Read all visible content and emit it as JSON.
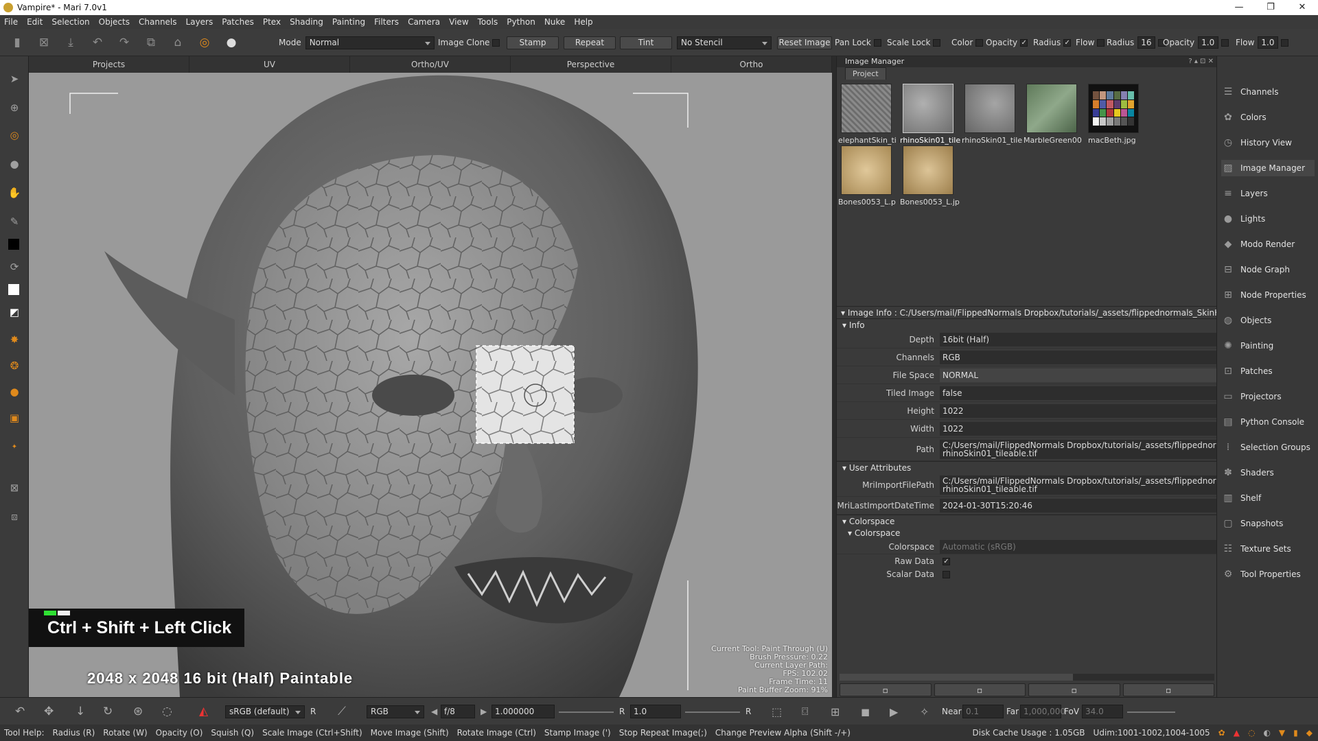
{
  "window": {
    "title": "Vampire* - Mari 7.0v1",
    "minimize": "—",
    "maximize": "❐",
    "close": "✕"
  },
  "menu": [
    "File",
    "Edit",
    "Selection",
    "Objects",
    "Channels",
    "Layers",
    "Patches",
    "Ptex",
    "Shading",
    "Painting",
    "Filters",
    "Camera",
    "View",
    "Tools",
    "Python",
    "Nuke",
    "Help"
  ],
  "toolbar": {
    "mode_label": "Mode",
    "mode_value": "Normal",
    "image_clone_label": "Image Clone",
    "stamp": "Stamp",
    "repeat": "Repeat",
    "tint": "Tint",
    "stencil_value": "No Stencil",
    "reset_image": "Reset Image",
    "pan_lock": "Pan Lock",
    "scale_lock": "Scale Lock",
    "color": "Color",
    "opacity": "Opacity",
    "radius": "Radius",
    "flow": "Flow",
    "radius_label": "Radius",
    "radius_value": "16",
    "opacity_label": "Opacity",
    "opacity_value": "1.0",
    "flow_label": "Flow",
    "flow_value": "1.0",
    "checkmark": "✓"
  },
  "viewport_tabs": [
    "Projects",
    "UV",
    "Ortho/UV",
    "Perspective",
    "Ortho"
  ],
  "viewport": {
    "hud": [
      "Current Tool: Paint Through (U)",
      "Brush Pressure: 0.22",
      "Current Layer Path:",
      "FPS: 102.02",
      "Frame Time: 11",
      "Paint Buffer Zoom: 91%"
    ],
    "key_tip": "Ctrl + Shift + Left Click",
    "paintable": "2048 x 2048 16 bit (Half) Paintable"
  },
  "image_manager": {
    "title": "Image Manager",
    "controls": "? ▴ ⊡ ✕",
    "tab": "Project",
    "thumbnails": [
      {
        "label": "elephantSkin_ti"
      },
      {
        "label": "rhinoSkin01_tile"
      },
      {
        "label": "rhinoSkin01_tile"
      },
      {
        "label": "MarbleGreen00"
      },
      {
        "label": "macBeth.jpg"
      },
      {
        "label": "Bones0053_L.p"
      },
      {
        "label": "Bones0053_L.jp"
      }
    ],
    "image_info_header": "Image Info : C:/Users/mail/FlippedNormals Dropbox/tutorials/_assets/flippednormals_SkinKi",
    "info_header": "Info",
    "info": [
      {
        "k": "Depth",
        "v": "16bit (Half)"
      },
      {
        "k": "Channels",
        "v": "RGB"
      },
      {
        "k": "File Space",
        "v": "NORMAL"
      },
      {
        "k": "Tiled Image",
        "v": "false"
      },
      {
        "k": "Height",
        "v": "1022"
      },
      {
        "k": "Width",
        "v": "1022"
      }
    ],
    "path_label": "Path",
    "path_line1": "C:/Users/mail/FlippedNormals Dropbox/tutorials/_assets/flippednorma",
    "path_line2": "rhinoSkin01_tileable.tif",
    "user_attr_header": "User Attributes",
    "import_path_label": "MriImportFilePath",
    "import_path_line1": "C:/Users/mail/FlippedNormals Dropbox/tutorials/_assets/flippednorma",
    "import_path_line2": "rhinoSkin01_tileable.tif",
    "import_date_label": "MriLastImportDateTime",
    "import_date": "2024-01-30T15:20:46",
    "colorspace_header": "Colorspace",
    "colorspace_sub": "Colorspace",
    "colorspace_label": "Colorspace",
    "colorspace_value": "Automatic (sRGB)",
    "raw_data_label": "Raw Data",
    "scalar_data_label": "Scalar Data"
  },
  "side_dock": [
    "Channels",
    "Colors",
    "History View",
    "Image Manager",
    "Layers",
    "Lights",
    "Modo Render",
    "Node Graph",
    "Node Properties",
    "Objects",
    "Painting",
    "Patches",
    "Projectors",
    "Python Console",
    "Selection Groups",
    "Shaders",
    "Shelf",
    "Snapshots",
    "Texture Sets",
    "Tool Properties"
  ],
  "bottom": {
    "colorspace": "sRGB (default)",
    "r1": "R",
    "channel": "RGB",
    "fstop": "f/8",
    "exposure": "1.000000",
    "r2": "R",
    "gamma": "1.0",
    "r3": "R",
    "near_label": "Near",
    "near": "0.1",
    "far_label": "Far",
    "far": "1,000,000",
    "fov_label": "FoV",
    "fov": "34.0"
  },
  "status": {
    "items": [
      "Tool Help:",
      "Radius (R)",
      "Rotate (W)",
      "Opacity (O)",
      "Squish (Q)",
      "Scale Image (Ctrl+Shift)",
      "Move Image (Shift)",
      "Rotate Image (Ctrl)",
      "Stamp Image (')",
      "Stop Repeat Image(;)",
      "Change Preview Alpha (Shift -/+)"
    ],
    "cache": "Disk Cache Usage : 1.05GB",
    "udim": "Udim:1001-1002,1004-1005"
  }
}
